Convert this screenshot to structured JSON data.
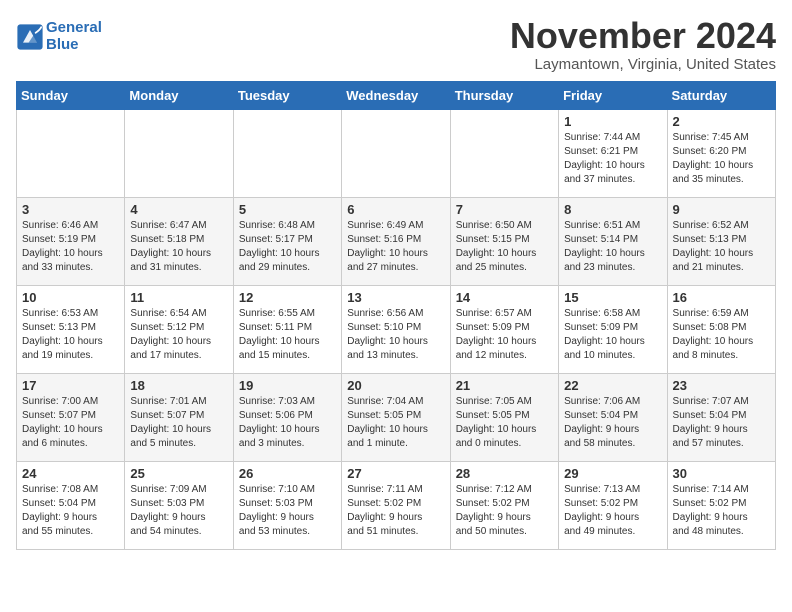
{
  "header": {
    "logo_line1": "General",
    "logo_line2": "Blue",
    "title": "November 2024",
    "location": "Laymantown, Virginia, United States"
  },
  "weekdays": [
    "Sunday",
    "Monday",
    "Tuesday",
    "Wednesday",
    "Thursday",
    "Friday",
    "Saturday"
  ],
  "weeks": [
    [
      {
        "day": "",
        "info": ""
      },
      {
        "day": "",
        "info": ""
      },
      {
        "day": "",
        "info": ""
      },
      {
        "day": "",
        "info": ""
      },
      {
        "day": "",
        "info": ""
      },
      {
        "day": "1",
        "info": "Sunrise: 7:44 AM\nSunset: 6:21 PM\nDaylight: 10 hours\nand 37 minutes."
      },
      {
        "day": "2",
        "info": "Sunrise: 7:45 AM\nSunset: 6:20 PM\nDaylight: 10 hours\nand 35 minutes."
      }
    ],
    [
      {
        "day": "3",
        "info": "Sunrise: 6:46 AM\nSunset: 5:19 PM\nDaylight: 10 hours\nand 33 minutes."
      },
      {
        "day": "4",
        "info": "Sunrise: 6:47 AM\nSunset: 5:18 PM\nDaylight: 10 hours\nand 31 minutes."
      },
      {
        "day": "5",
        "info": "Sunrise: 6:48 AM\nSunset: 5:17 PM\nDaylight: 10 hours\nand 29 minutes."
      },
      {
        "day": "6",
        "info": "Sunrise: 6:49 AM\nSunset: 5:16 PM\nDaylight: 10 hours\nand 27 minutes."
      },
      {
        "day": "7",
        "info": "Sunrise: 6:50 AM\nSunset: 5:15 PM\nDaylight: 10 hours\nand 25 minutes."
      },
      {
        "day": "8",
        "info": "Sunrise: 6:51 AM\nSunset: 5:14 PM\nDaylight: 10 hours\nand 23 minutes."
      },
      {
        "day": "9",
        "info": "Sunrise: 6:52 AM\nSunset: 5:13 PM\nDaylight: 10 hours\nand 21 minutes."
      }
    ],
    [
      {
        "day": "10",
        "info": "Sunrise: 6:53 AM\nSunset: 5:13 PM\nDaylight: 10 hours\nand 19 minutes."
      },
      {
        "day": "11",
        "info": "Sunrise: 6:54 AM\nSunset: 5:12 PM\nDaylight: 10 hours\nand 17 minutes."
      },
      {
        "day": "12",
        "info": "Sunrise: 6:55 AM\nSunset: 5:11 PM\nDaylight: 10 hours\nand 15 minutes."
      },
      {
        "day": "13",
        "info": "Sunrise: 6:56 AM\nSunset: 5:10 PM\nDaylight: 10 hours\nand 13 minutes."
      },
      {
        "day": "14",
        "info": "Sunrise: 6:57 AM\nSunset: 5:09 PM\nDaylight: 10 hours\nand 12 minutes."
      },
      {
        "day": "15",
        "info": "Sunrise: 6:58 AM\nSunset: 5:09 PM\nDaylight: 10 hours\nand 10 minutes."
      },
      {
        "day": "16",
        "info": "Sunrise: 6:59 AM\nSunset: 5:08 PM\nDaylight: 10 hours\nand 8 minutes."
      }
    ],
    [
      {
        "day": "17",
        "info": "Sunrise: 7:00 AM\nSunset: 5:07 PM\nDaylight: 10 hours\nand 6 minutes."
      },
      {
        "day": "18",
        "info": "Sunrise: 7:01 AM\nSunset: 5:07 PM\nDaylight: 10 hours\nand 5 minutes."
      },
      {
        "day": "19",
        "info": "Sunrise: 7:03 AM\nSunset: 5:06 PM\nDaylight: 10 hours\nand 3 minutes."
      },
      {
        "day": "20",
        "info": "Sunrise: 7:04 AM\nSunset: 5:05 PM\nDaylight: 10 hours\nand 1 minute."
      },
      {
        "day": "21",
        "info": "Sunrise: 7:05 AM\nSunset: 5:05 PM\nDaylight: 10 hours\nand 0 minutes."
      },
      {
        "day": "22",
        "info": "Sunrise: 7:06 AM\nSunset: 5:04 PM\nDaylight: 9 hours\nand 58 minutes."
      },
      {
        "day": "23",
        "info": "Sunrise: 7:07 AM\nSunset: 5:04 PM\nDaylight: 9 hours\nand 57 minutes."
      }
    ],
    [
      {
        "day": "24",
        "info": "Sunrise: 7:08 AM\nSunset: 5:04 PM\nDaylight: 9 hours\nand 55 minutes."
      },
      {
        "day": "25",
        "info": "Sunrise: 7:09 AM\nSunset: 5:03 PM\nDaylight: 9 hours\nand 54 minutes."
      },
      {
        "day": "26",
        "info": "Sunrise: 7:10 AM\nSunset: 5:03 PM\nDaylight: 9 hours\nand 53 minutes."
      },
      {
        "day": "27",
        "info": "Sunrise: 7:11 AM\nSunset: 5:02 PM\nDaylight: 9 hours\nand 51 minutes."
      },
      {
        "day": "28",
        "info": "Sunrise: 7:12 AM\nSunset: 5:02 PM\nDaylight: 9 hours\nand 50 minutes."
      },
      {
        "day": "29",
        "info": "Sunrise: 7:13 AM\nSunset: 5:02 PM\nDaylight: 9 hours\nand 49 minutes."
      },
      {
        "day": "30",
        "info": "Sunrise: 7:14 AM\nSunset: 5:02 PM\nDaylight: 9 hours\nand 48 minutes."
      }
    ]
  ]
}
